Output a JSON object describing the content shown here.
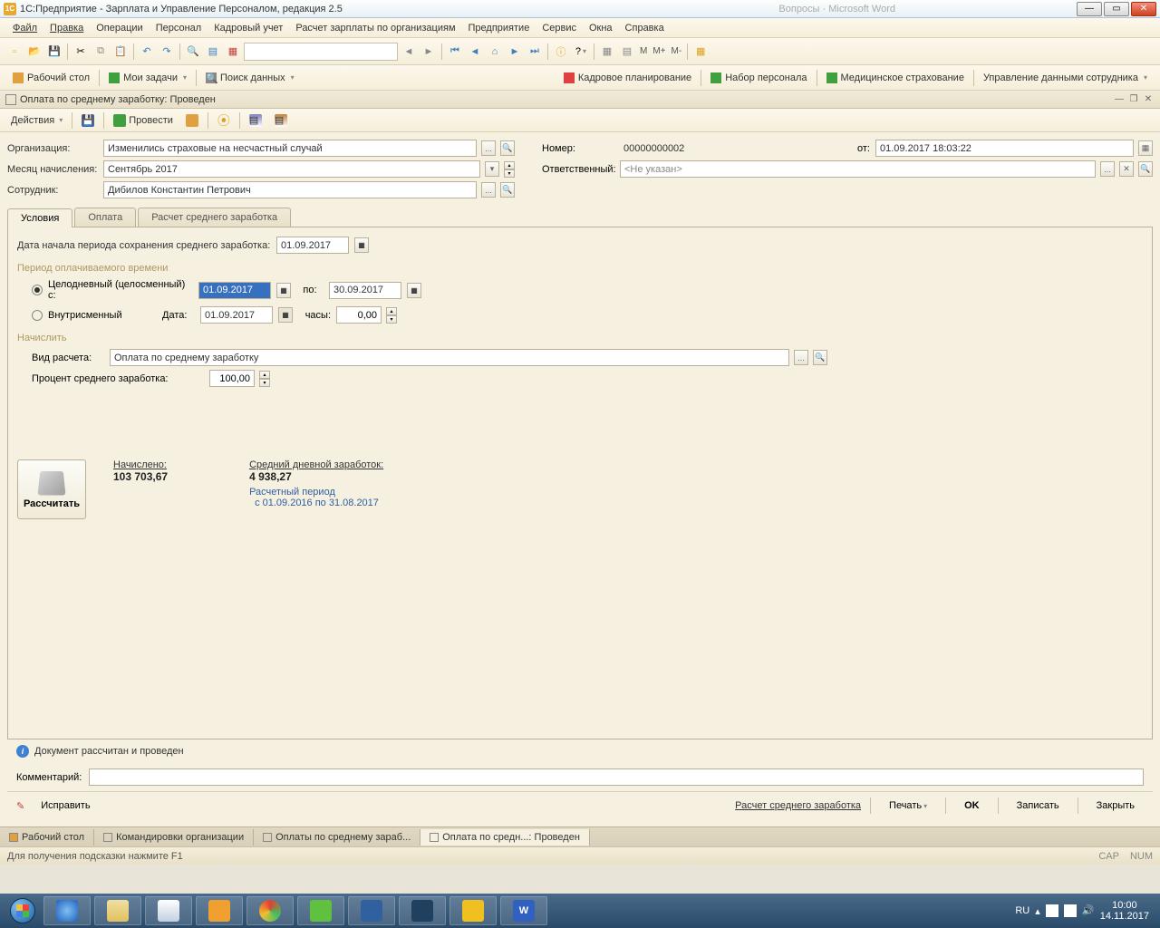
{
  "title": "1С:Предприятие - Зарплата и Управление Персоналом, редакция 2.5",
  "titlebar_faded": "Вопросы · Microsoft Word",
  "menu": [
    "Файл",
    "Правка",
    "Операции",
    "Персонал",
    "Кадровый учет",
    "Расчет зарплаты по организациям",
    "Предприятие",
    "Сервис",
    "Окна",
    "Справка"
  ],
  "tb": {
    "m": "М",
    "mplus": "М+",
    "mminus": "М-"
  },
  "nav": {
    "desktop": "Рабочий стол",
    "mytasks": "Мои задачи",
    "search": "Поиск данных",
    "kadr_plan": "Кадровое планирование",
    "recruit": "Набор персонала",
    "medins": "Медицинское страхование",
    "empdata": "Управление данными сотрудника"
  },
  "doc_title": "Оплата по среднему заработку: Проведен",
  "actions": {
    "actions": "Действия",
    "post": "Провести"
  },
  "form": {
    "org_label": "Организация:",
    "org_value": "Изменились страховые на несчастный случай",
    "month_label": "Месяц начисления:",
    "month_value": "Сентябрь 2017",
    "emp_label": "Сотрудник:",
    "emp_value": "Дибилов Константин Петрович",
    "num_label": "Номер:",
    "num_value": "00000000002",
    "ot_label": "от:",
    "date_value": "01.09.2017 18:03:22",
    "resp_label": "Ответственный:",
    "resp_value": "<Не указан>"
  },
  "tabs": [
    "Условия",
    "Оплата",
    "Расчет среднего заработка"
  ],
  "cond": {
    "startdate_label": "Дата начала периода сохранения среднего заработка:",
    "startdate": "01.09.2017",
    "period_group": "Период оплачиваемого времени",
    "radio_fullday": "Целодневный (целосменный) с:",
    "date_from": "01.09.2017",
    "po": "по:",
    "date_to": "30.09.2017",
    "radio_intra": "Внутрисменный",
    "date_label": "Дата:",
    "intra_date": "01.09.2017",
    "hours_label": "часы:",
    "hours_value": "0,00",
    "accrual_group": "Начислить",
    "calc_type_label": "Вид расчета:",
    "calc_type_value": "Оплата по среднему заработку",
    "percent_label": "Процент среднего заработка:",
    "percent_value": "100,00"
  },
  "calc": {
    "btn": "Рассчитать",
    "accrued_label": "Начислено:",
    "accrued_value": "103 703,67",
    "avg_label": "Средний дневной заработок:",
    "avg_value": "4 938,27",
    "period_label": "Расчетный период",
    "period_range": "с 01.09.2016 по 31.08.2017"
  },
  "status_msg": "Документ рассчитан и проведен",
  "comment_label": "Комментарий:",
  "bottom": {
    "fix": "Исправить",
    "avgcalc": "Расчет среднего заработка",
    "print": "Печать",
    "ok": "OK",
    "save": "Записать",
    "close": "Закрыть"
  },
  "wintabs": [
    "Рабочий стол",
    "Командировки организации",
    "Оплаты по среднему зараб...",
    "Оплата по средн...: Проведен"
  ],
  "statusbar": {
    "hint": "Для получения подсказки нажмите F1",
    "cap": "CAP",
    "num": "NUM"
  },
  "tray": {
    "lang": "RU",
    "time": "10:00",
    "date": "14.11.2017"
  }
}
